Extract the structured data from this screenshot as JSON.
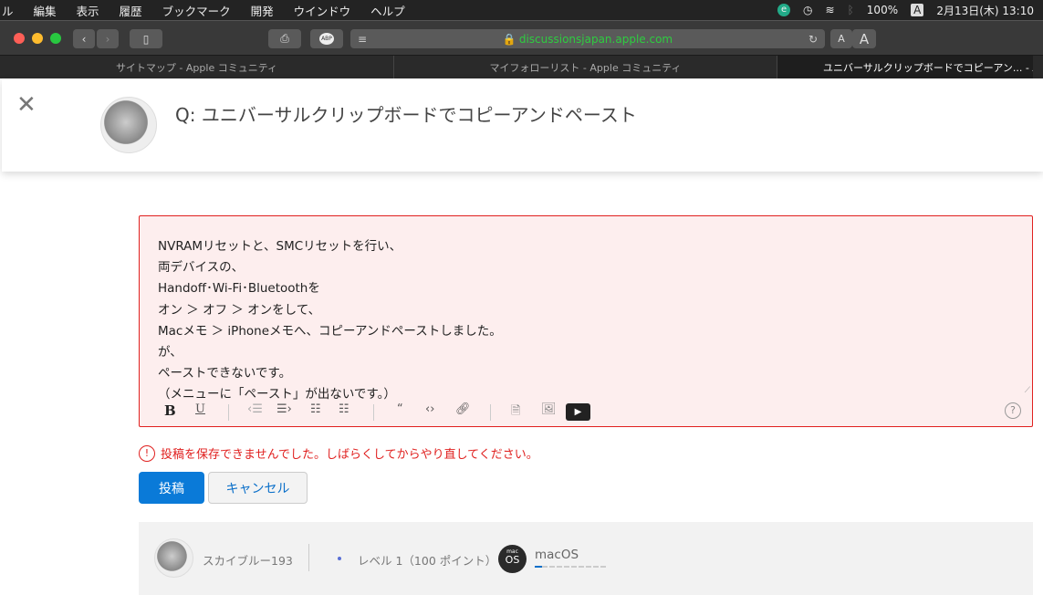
{
  "menubar": {
    "items": [
      "ル",
      "編集",
      "表示",
      "履歴",
      "ブックマーク",
      "開発",
      "ウインドウ",
      "ヘルプ"
    ],
    "battery": "100%",
    "input": "A",
    "datetime": "2月13日(木) 13:10"
  },
  "browser": {
    "url": "discussionsjapan.apple.com",
    "font_small": "A",
    "font_large": "A",
    "abp": "ABP"
  },
  "tabs": [
    {
      "label": "サイトマップ - Apple コミュニティ"
    },
    {
      "label": "マイフォローリスト - Apple コミュニティ"
    },
    {
      "label": "ユニバーサルクリップボードでコピーアン... - Apple"
    }
  ],
  "question": {
    "prefix": "Q:",
    "title": "ユニバーサルクリップボードでコピーアンドペースト"
  },
  "editor": {
    "lines": [
      "NVRAMリセットと、SMCリセットを行い、",
      "両デバイスの、",
      "Handoff･Wi-Fi･Bluetoothを",
      "オン ＞ オフ ＞ オンをして、",
      "Macメモ ＞ iPhoneメモへ、コピーアンドペーストしました。",
      "が、",
      "ペーストできないです。",
      "（メニューに「ペースト」が出ないです。）"
    ],
    "bold": "B",
    "underline": "U",
    "help": "?"
  },
  "error": "投稿を保存できませんでした。しばらくしてからやり直してください。",
  "buttons": {
    "post": "投稿",
    "cancel": "キャンセル"
  },
  "user": {
    "name": "スカイブルー193",
    "level": "レベル 1（100 ポイント）",
    "badge_top": "mac",
    "badge": "OS",
    "community": "macOS",
    "community_progress": 0.1
  },
  "colors": {
    "error": "#e0201f",
    "primary": "#0a7ad8",
    "url": "#2ecc40"
  }
}
